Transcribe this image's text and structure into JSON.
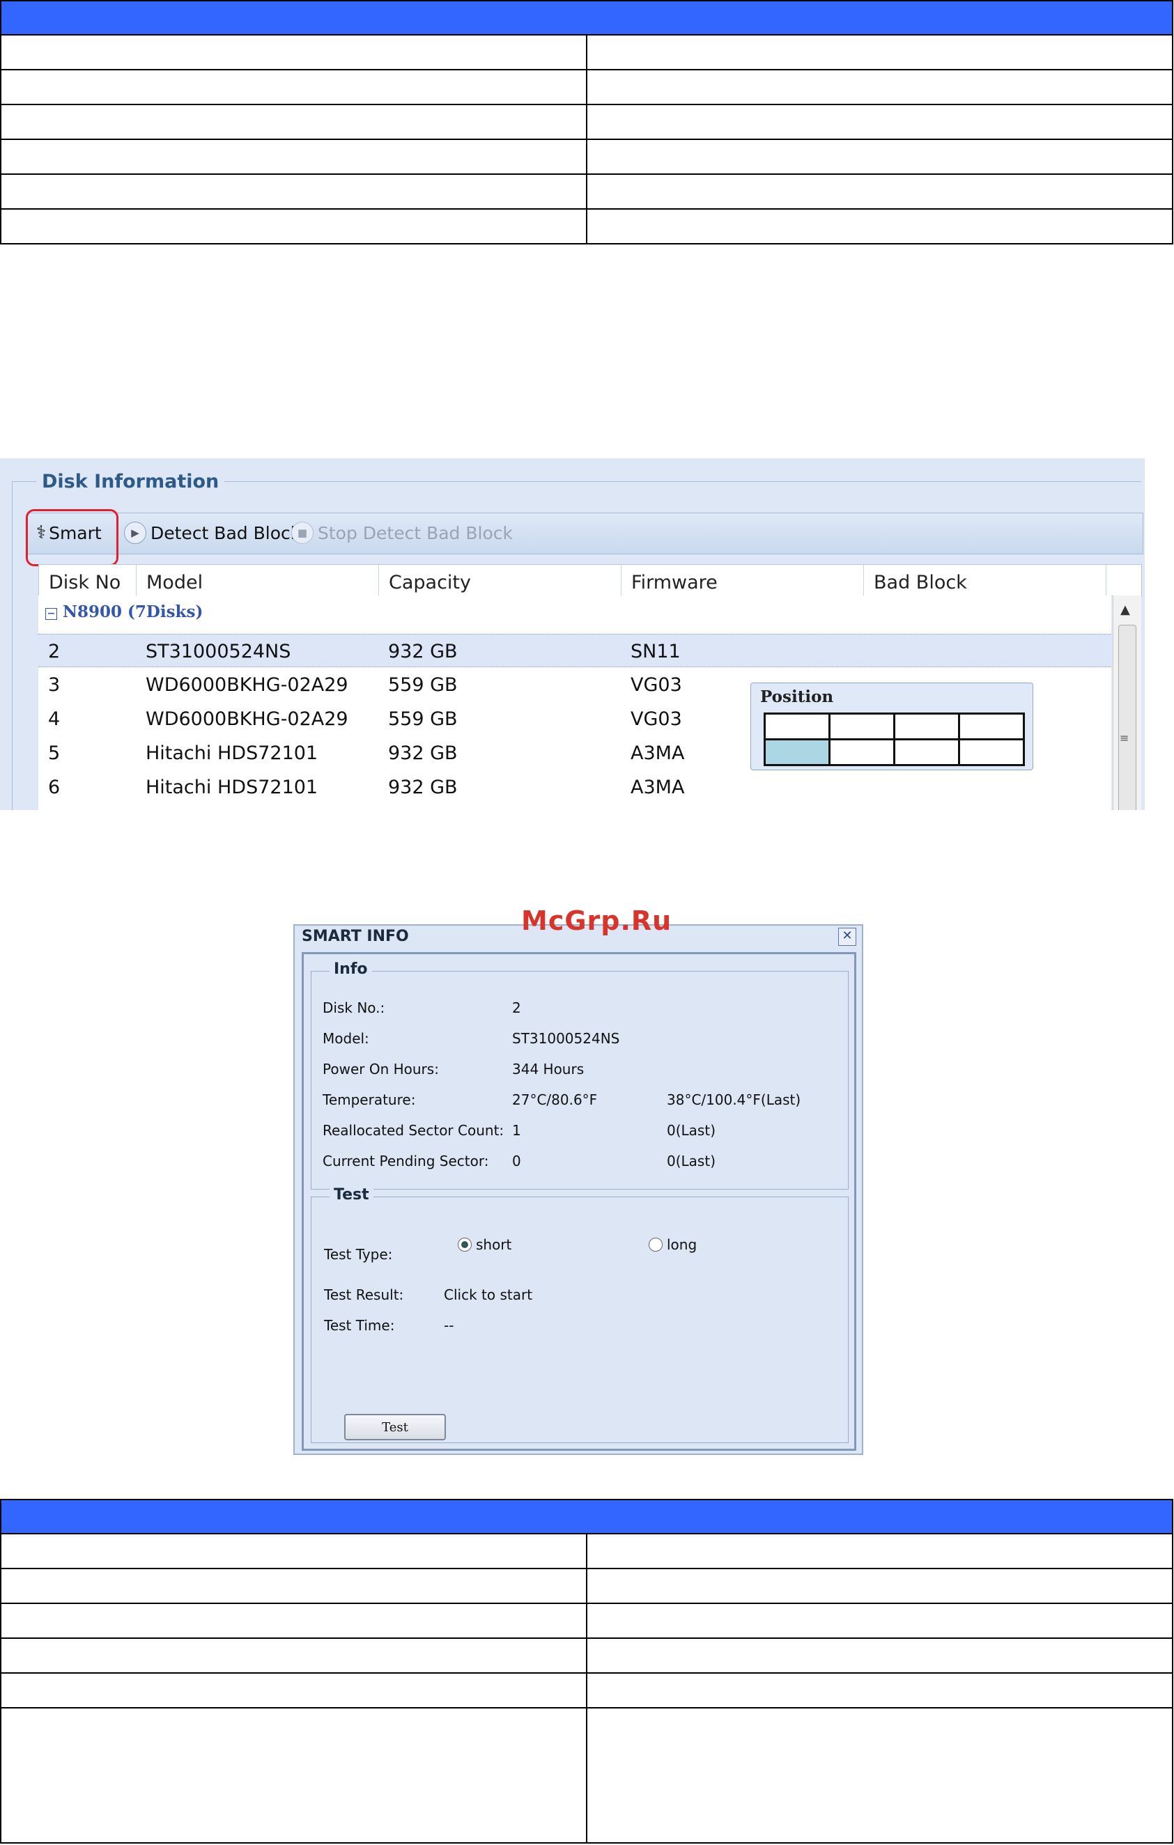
{
  "disk_panel": {
    "legend": "Disk Information",
    "toolbar": {
      "smart": "Smart",
      "detect": "Detect Bad Block",
      "stop": "Stop Detect Bad Block"
    },
    "columns": [
      "Disk No",
      "Model",
      "Capacity",
      "Firmware",
      "Bad Block"
    ],
    "group": "N8900 (7Disks)",
    "rows": [
      {
        "no": "2",
        "model": "ST31000524NS",
        "capacity": "932 GB",
        "firmware": "SN11"
      },
      {
        "no": "3",
        "model": "WD6000BKHG-02A29",
        "capacity": "559 GB",
        "firmware": "VG03"
      },
      {
        "no": "4",
        "model": "WD6000BKHG-02A29",
        "capacity": "559 GB",
        "firmware": "VG03"
      },
      {
        "no": "5",
        "model": "Hitachi HDS72101",
        "capacity": "932 GB",
        "firmware": "A3MA"
      },
      {
        "no": "6",
        "model": "Hitachi HDS72101",
        "capacity": "932 GB",
        "firmware": "A3MA"
      }
    ],
    "position_popup": {
      "title": "Position",
      "selected_slot": 5
    }
  },
  "watermark": "McGrp.Ru",
  "smart_dialog": {
    "title": "SMART INFO",
    "info_legend": "Info",
    "info": {
      "disk_no_label": "Disk No.:",
      "disk_no": "2",
      "model_label": "Model:",
      "model": "ST31000524NS",
      "hours_label": "Power On Hours:",
      "hours": "344 Hours",
      "temp_label": "Temperature:",
      "temp": "27°C/80.6°F",
      "temp_last": "38°C/100.4°F(Last)",
      "realloc_label": "Reallocated Sector Count:",
      "realloc": "1",
      "realloc_last": "0(Last)",
      "pending_label": "Current Pending Sector:",
      "pending": "0",
      "pending_last": "0(Last)"
    },
    "test_legend": "Test",
    "test": {
      "type_label": "Test Type:",
      "short": "short",
      "long": "long",
      "selected": "short",
      "result_label": "Test Result:",
      "result": "Click to start",
      "time_label": "Test Time:",
      "time": "--",
      "button": "Test"
    }
  }
}
